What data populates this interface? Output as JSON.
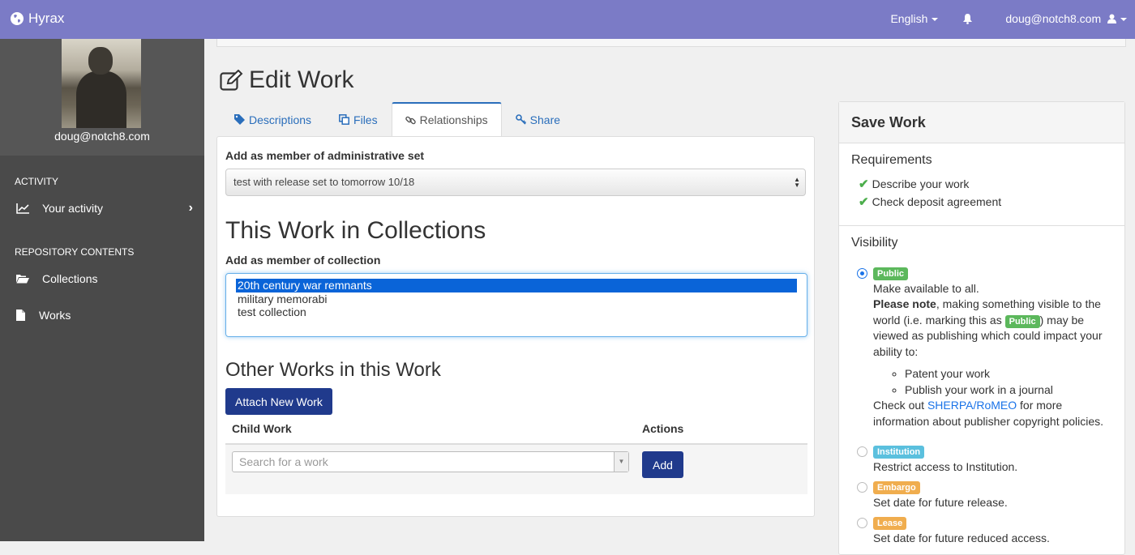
{
  "topbar": {
    "brand": "Hyrax",
    "language": "English",
    "user": "doug@notch8.com"
  },
  "sidebar": {
    "user_name": "doug@notch8.com",
    "activity_heading": "ACTIVITY",
    "your_activity": "Your activity",
    "repository_heading": "REPOSITORY CONTENTS",
    "collections": "Collections",
    "works": "Works"
  },
  "page": {
    "title": "Edit Work"
  },
  "tabs": [
    {
      "label": "Descriptions",
      "icon": "tag-icon"
    },
    {
      "label": "Files",
      "icon": "files-icon"
    },
    {
      "label": "Relationships",
      "icon": "link-icon"
    },
    {
      "label": "Share",
      "icon": "key-icon"
    }
  ],
  "relationships": {
    "admin_set_label": "Add as member of administrative set",
    "admin_set_value": "test with release set to tomorrow 10/18",
    "collections_heading": "This Work in Collections",
    "collection_label": "Add as member of collection",
    "collection_options": [
      "20th century war remnants",
      "military memorabi",
      "test collection"
    ],
    "collection_selected": "20th century war remnants",
    "other_works_heading": "Other Works in this Work",
    "attach_button": "Attach New Work",
    "col_child": "Child Work",
    "col_actions": "Actions",
    "search_placeholder": "Search for a work",
    "add_button": "Add"
  },
  "save_work": {
    "title": "Save Work",
    "requirements_title": "Requirements",
    "req_describe": "Describe your work",
    "req_agreement": "Check deposit agreement",
    "visibility_title": "Visibility",
    "public_badge": "Public",
    "public_desc": "Make available to all.",
    "note_bold": "Please note",
    "note_text_1": ", making something visible to the world (i.e. marking this as ",
    "note_text_2": ") may be viewed as publishing which could impact your ability to:",
    "bullet_1": "Patent your work",
    "bullet_2": "Publish your work in a journal",
    "check_out": "Check out ",
    "sherpa_link": "SHERPA/RoMEO",
    "check_out_rest": " for more information about publisher copyright policies.",
    "institution_badge": "Institution",
    "institution_desc": "Restrict access to Institution.",
    "embargo_badge": "Embargo",
    "embargo_desc": "Set date for future release.",
    "lease_badge": "Lease",
    "lease_desc": "Set date for future reduced access."
  },
  "colors": {
    "topbar": "#7b7bc6",
    "sidebar": "#4a4a4a",
    "primary_button": "#203a8c",
    "link": "#2a6ebb",
    "public": "#5cb85c",
    "institution": "#5bc0de",
    "embargo": "#f0ad4e"
  }
}
